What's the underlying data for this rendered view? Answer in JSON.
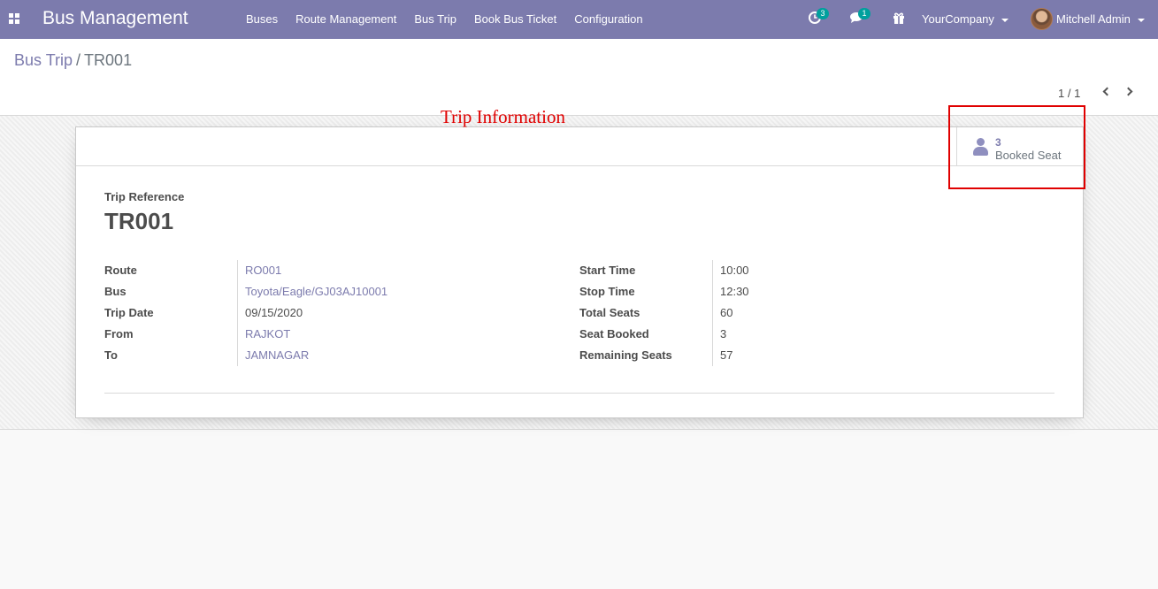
{
  "navbar": {
    "app_name": "Bus Management",
    "menu": [
      "Buses",
      "Route Management",
      "Bus Trip",
      "Book Bus Ticket",
      "Configuration"
    ],
    "activity_count": "3",
    "messages_count": "1",
    "company": "YourCompany",
    "user": "Mitchell Admin",
    "color": "#7c7bad"
  },
  "breadcrumb": {
    "parent": "Bus Trip",
    "separator": "/",
    "current": "TR001"
  },
  "pager": {
    "value": "1 / 1"
  },
  "stat_button": {
    "value": "3",
    "label": "Booked Seat"
  },
  "form": {
    "ref_label": "Trip Reference",
    "ref_value": "TR001",
    "left_fields": [
      {
        "label": "Route",
        "value": "RO001"
      },
      {
        "label": "Bus",
        "value": "Toyota/Eagle/GJ03AJ10001"
      },
      {
        "label": "Trip Date",
        "value": "09/15/2020"
      },
      {
        "label": "From",
        "value": "RAJKOT"
      },
      {
        "label": "To",
        "value": "JAMNAGAR"
      }
    ],
    "right_fields": [
      {
        "label": "Start Time",
        "value": "10:00"
      },
      {
        "label": "Stop Time",
        "value": "12:30"
      },
      {
        "label": "Total Seats",
        "value": "60"
      },
      {
        "label": "Seat Booked",
        "value": "3"
      },
      {
        "label": "Remaining Seats",
        "value": "57"
      }
    ]
  },
  "annotation": {
    "title": "Trip Information",
    "color": "#e00000"
  }
}
